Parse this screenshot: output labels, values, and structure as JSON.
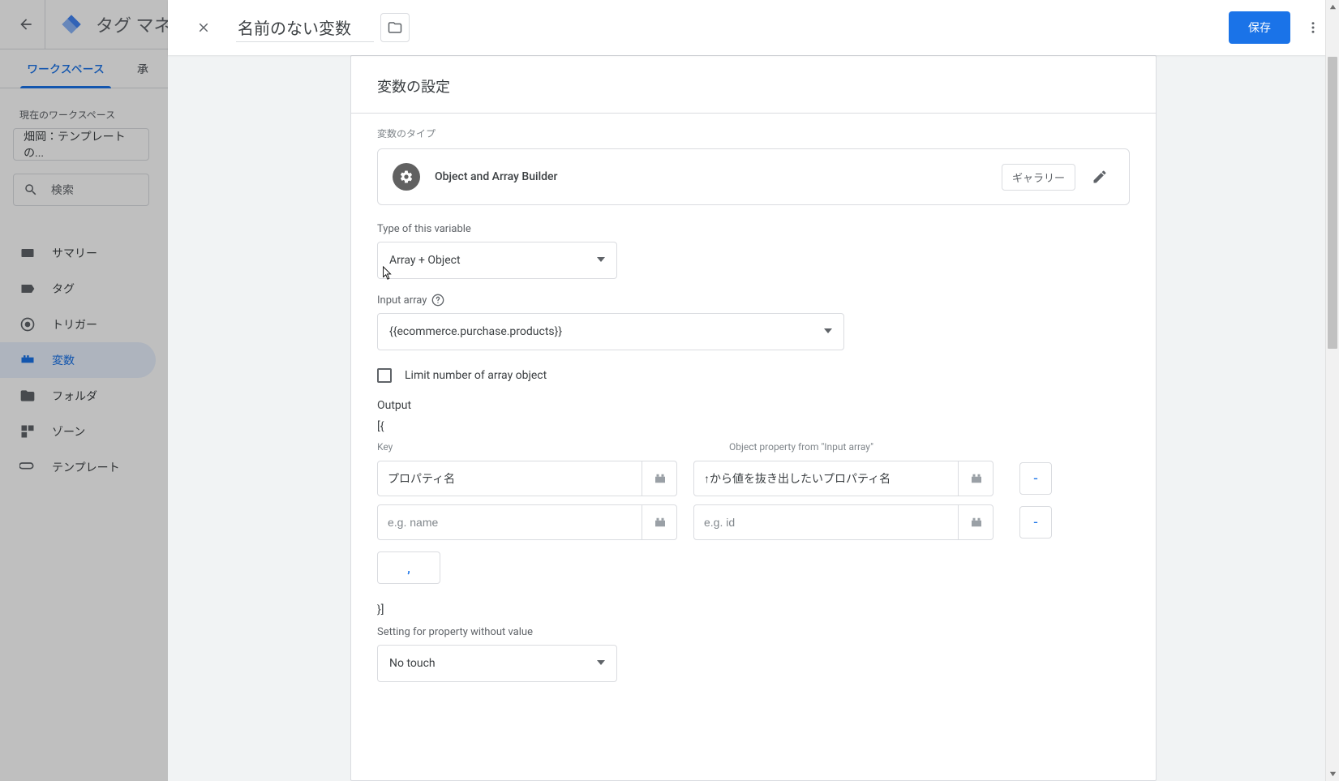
{
  "gtm": {
    "title": "タグ マネ",
    "tabs": {
      "workspace": "ワークスペース",
      "versions": "承"
    },
    "ws_label": "現在のワークスペース",
    "ws_name": "畑岡：テンプレートの...",
    "search_placeholder": "検索",
    "nav": {
      "summary": "サマリー",
      "tags": "タグ",
      "triggers": "トリガー",
      "variables": "変数",
      "folders": "フォルダ",
      "zones": "ゾーン",
      "templates": "テンプレート"
    }
  },
  "modal": {
    "title": "名前のない変数",
    "save": "保存",
    "card_title": "変数の設定",
    "var_type_label": "変数のタイプ",
    "var_type_name": "Object and Array Builder",
    "gallery": "ギャラリー",
    "type_label": "Type of this variable",
    "type_value": "Array + Object",
    "input_array_label": "Input array",
    "input_array_value": "{{ecommerce.purchase.products}}",
    "limit_label": "Limit number of array object",
    "output_label": "Output",
    "open_brace": "[{",
    "close_brace": "}]",
    "key_label": "Key",
    "obj_prop_label": "Object property from \"Input array\"",
    "row1": {
      "key": "プロパティ名",
      "prop": "↑から値を抜き出したいプロパティ名"
    },
    "row2": {
      "key_ph": "e.g. name",
      "prop_ph": "e.g. id"
    },
    "minus": "-",
    "comma": ",",
    "setting_label": "Setting for property without value",
    "setting_value": "No touch"
  }
}
